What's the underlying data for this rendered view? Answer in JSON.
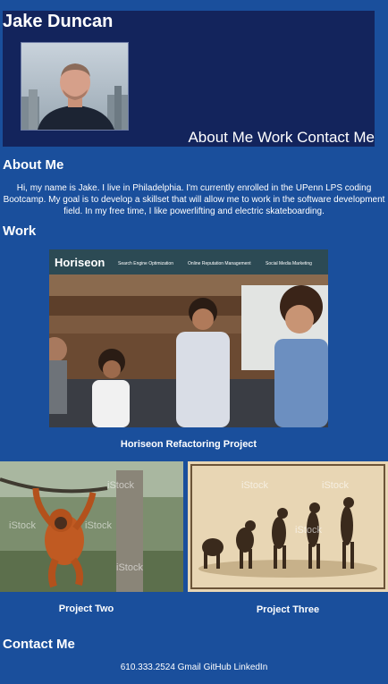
{
  "header": {
    "name": "Jake Duncan",
    "nav": [
      "About Me",
      "Work",
      "Contact Me"
    ]
  },
  "about": {
    "heading": "About Me",
    "text": "Hi, my name is Jake. I live in Philadelphia. I'm currently enrolled in the UPenn LPS coding Bootcamp. My goal is to develop a skillset that will allow me to work in the software development field. In my free time, I like powerlifting and electric skateboarding."
  },
  "work": {
    "heading": "Work",
    "featured": {
      "title": "Horiseon Refactoring Project",
      "site_brand": "Horiseon",
      "site_nav": [
        "Search Engine Optimization",
        "Online Reputation Management",
        "Social Media Marketing"
      ]
    },
    "projects": [
      {
        "title": "Project Two",
        "watermark": "iStock"
      },
      {
        "title": "Project Three",
        "watermark": "iStock"
      }
    ]
  },
  "contact": {
    "heading": "Contact Me",
    "links": [
      "610.333.2524",
      "Gmail",
      "GitHub",
      "LinkedIn"
    ]
  },
  "colors": {
    "page_bg": "#1a4f9c",
    "header_bg": "#13245c",
    "text": "#ffffff"
  }
}
